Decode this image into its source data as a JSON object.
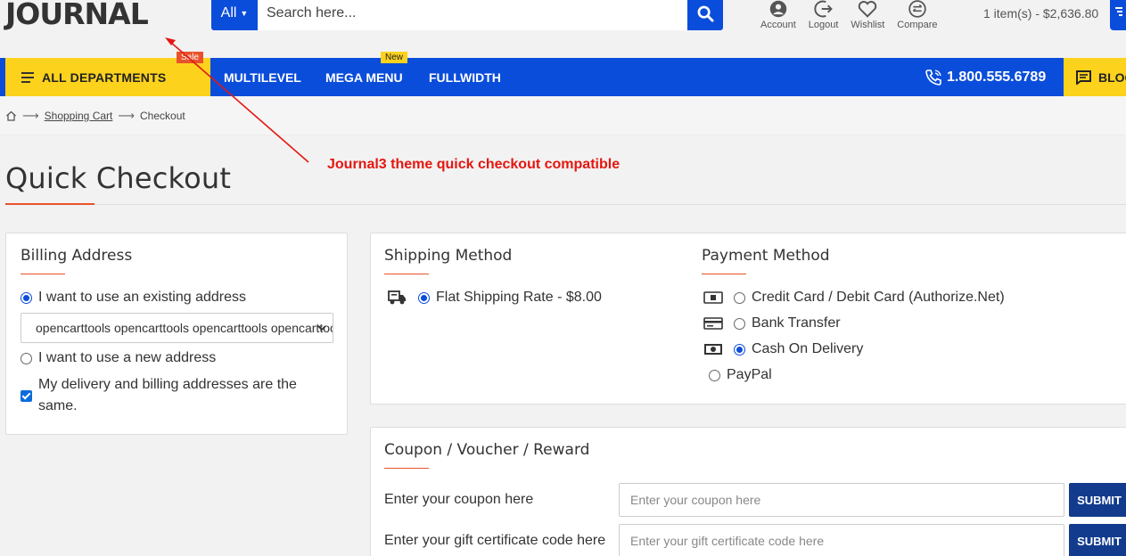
{
  "header": {
    "logo": "JOURNAL",
    "search": {
      "category": "All",
      "placeholder": "Search here..."
    },
    "links": [
      "Account",
      "Logout",
      "Wishlist",
      "Compare"
    ],
    "cart": "1 item(s) - $2,636.80"
  },
  "nav": {
    "departments": "ALL DEPARTMENTS",
    "sale_badge": "Sale",
    "items": [
      "MULTILEVEL",
      "MEGA MENU",
      "FULLWIDTH"
    ],
    "new_badge": "New",
    "phone": "1.800.555.6789",
    "blog": "BLOG"
  },
  "breadcrumb": [
    "Shopping Cart",
    "Checkout"
  ],
  "page_title": "Quick Checkout",
  "annotation": "Journal3 theme quick checkout compatible",
  "billing": {
    "title": "Billing Address",
    "existing_label": "I want to use an existing address",
    "address_selected": "opencarttools opencarttools opencarttools opencarttools",
    "new_label": "I want to use a new address",
    "same_label": "My delivery and billing addresses are the same."
  },
  "shipping": {
    "title": "Shipping Method",
    "option": "Flat Shipping Rate - $8.00"
  },
  "payment": {
    "title": "Payment Method",
    "options": [
      {
        "label": "Credit Card / Debit Card (Authorize.Net)",
        "icon": "credit-card-icon",
        "selected": false
      },
      {
        "label": "Bank Transfer",
        "icon": "bank-card-icon",
        "selected": false
      },
      {
        "label": "Cash On Delivery",
        "icon": "cash-icon",
        "selected": true
      },
      {
        "label": "PayPal",
        "icon": "",
        "selected": false
      }
    ]
  },
  "coupon": {
    "title": "Coupon / Voucher / Reward",
    "coupon_label": "Enter your coupon here",
    "coupon_placeholder": "Enter your coupon here",
    "gift_label": "Enter your gift certificate code here",
    "gift_placeholder": "Enter your gift certificate code here",
    "submit": "SUBMIT"
  },
  "colors": {
    "primary": "#0b4ddb",
    "accent": "#fcd21d",
    "sale": "#e8522a",
    "annotation": "#e4170f"
  }
}
